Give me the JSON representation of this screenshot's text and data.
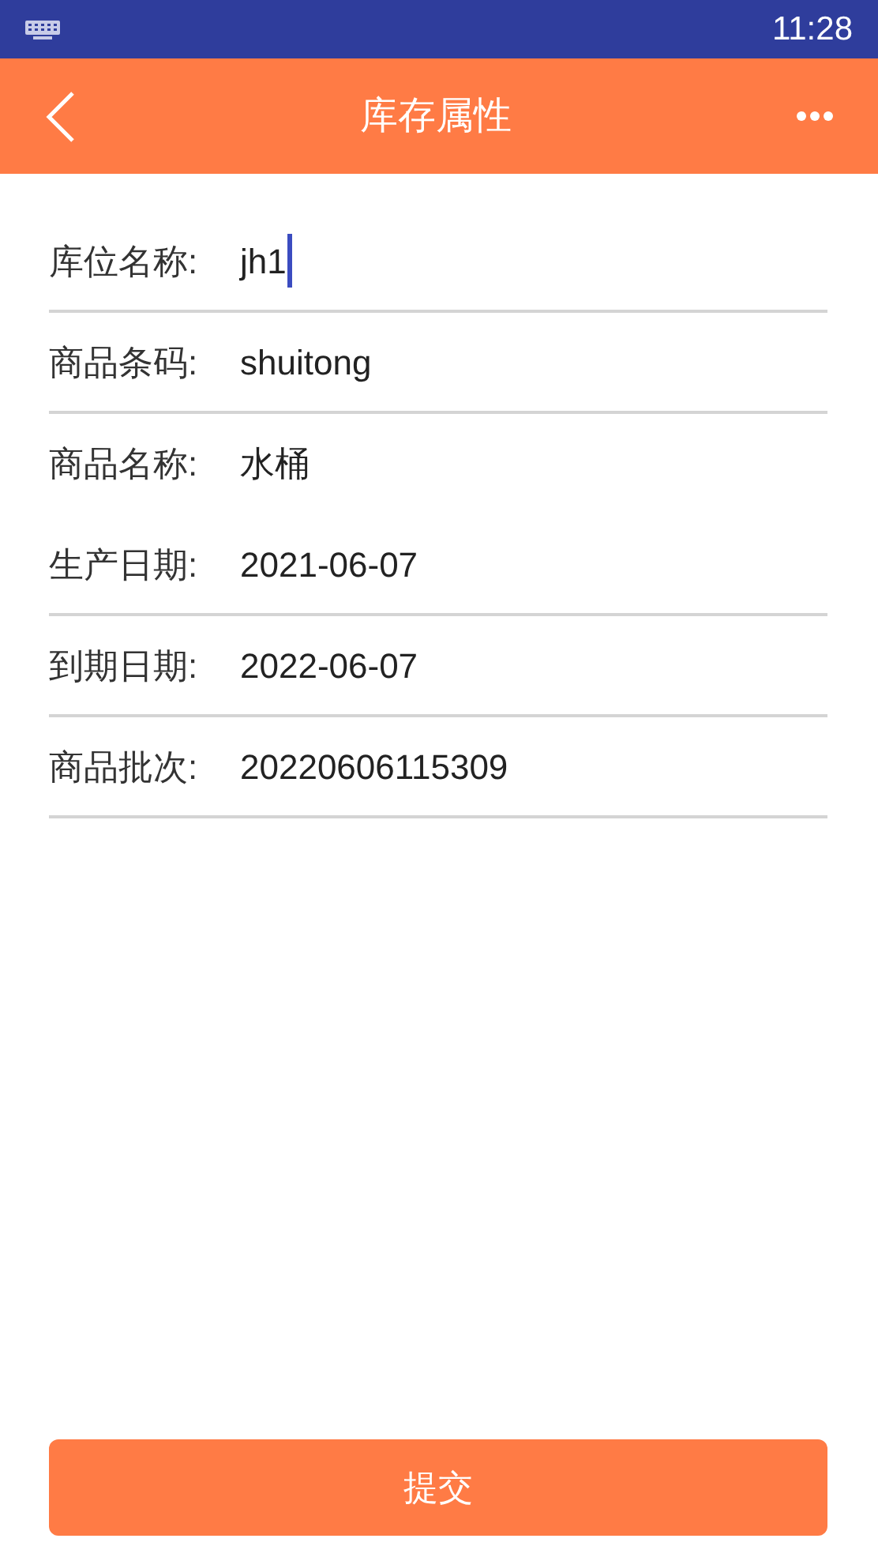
{
  "status_bar": {
    "time": "11:28"
  },
  "header": {
    "title": "库存属性"
  },
  "fields": [
    {
      "label": "库位名称:",
      "value": "jh1",
      "kind": "input",
      "focused": true
    },
    {
      "label": "商品条码:",
      "value": "shuitong",
      "kind": "input",
      "focused": false
    },
    {
      "label": "商品名称:",
      "value": "水桶",
      "kind": "text",
      "focused": false
    },
    {
      "label": "生产日期:",
      "value": "2021-06-07",
      "kind": "input",
      "focused": false
    },
    {
      "label": "到期日期:",
      "value": "2022-06-07",
      "kind": "input",
      "focused": false
    },
    {
      "label": "商品批次:",
      "value": "20220606115309",
      "kind": "input",
      "focused": false
    }
  ],
  "submit_button": "提交"
}
